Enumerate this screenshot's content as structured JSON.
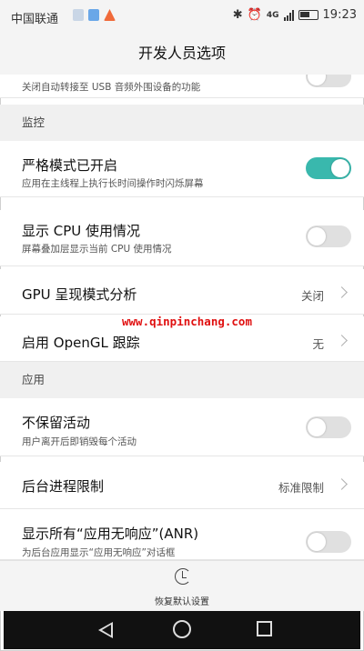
{
  "status_bar": {
    "carrier": "中国联通",
    "network": "4G",
    "time": "19:23"
  },
  "header": {
    "title": "开发人员选项"
  },
  "partial_row": {
    "subtitle": "关闭自动转接至 USB 音频外围设备的功能",
    "toggle_on": false
  },
  "sections": [
    {
      "label": "监控"
    },
    {
      "label": "应用"
    }
  ],
  "rows": [
    {
      "title": "严格模式已开启",
      "subtitle": "应用在主线程上执行长时间操作时闪烁屏幕",
      "toggle_on": true
    },
    {
      "title": "显示 CPU 使用情况",
      "subtitle": "屏幕叠加层显示当前 CPU 使用情况",
      "toggle_on": false
    },
    {
      "title": "GPU 呈现模式分析",
      "value": "关闭"
    },
    {
      "title": "启用 OpenGL 跟踪",
      "value": "无"
    },
    {
      "title": "不保留活动",
      "subtitle": "用户离开后即销毁每个活动",
      "toggle_on": false
    },
    {
      "title": "后台进程限制",
      "value": "标准限制"
    },
    {
      "title": "显示所有“应用无响应”(ANR)",
      "subtitle": "为后台应用显示“应用无响应”对话框",
      "toggle_on": false
    }
  ],
  "watermark": "www.qinpinchang.com",
  "footer": {
    "reset_label": "恢复默认设置"
  },
  "colors": {
    "toggle_on": "#39b8ad",
    "toggle_off": "#e0e0e0",
    "watermark": "#e01010"
  },
  "icons": [
    "bluetooth-icon",
    "alarm-icon",
    "signal-icon",
    "battery-icon",
    "reset-icon",
    "back-icon",
    "home-icon",
    "recents-icon"
  ]
}
